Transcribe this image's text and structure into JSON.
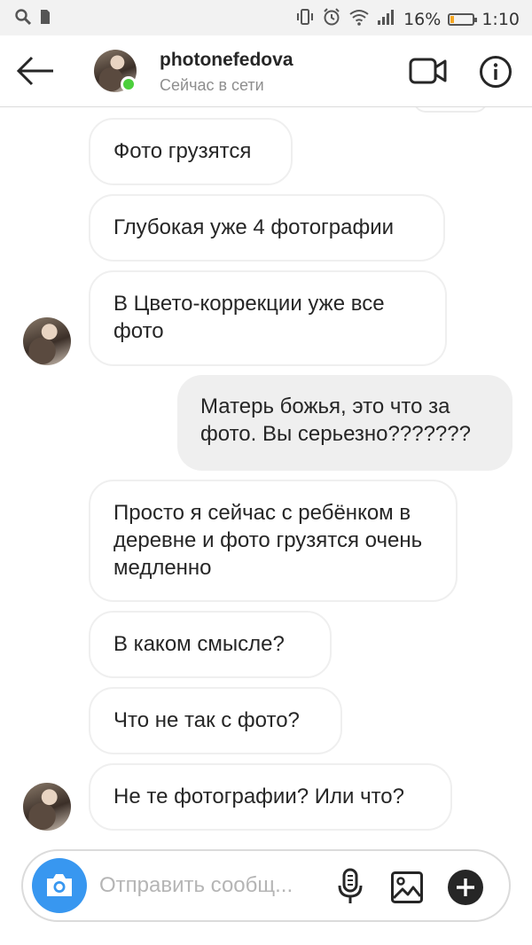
{
  "status_bar": {
    "icons_left": [
      "search-icon",
      "sim-icon"
    ],
    "icons_right": [
      "vibrate-icon",
      "alarm-icon",
      "wifi-icon",
      "signal-icon"
    ],
    "battery_percent": "16%",
    "battery_level": 0.16,
    "battery_color": "#f5a623",
    "time": "1:10"
  },
  "header": {
    "username": "photonefedova",
    "presence": "Сейчас в сети",
    "online_color": "#4ccf3c"
  },
  "messages": [
    {
      "side": "in",
      "text": "Фото грузятся"
    },
    {
      "side": "in",
      "text": "Глубокая уже 4 фотографии"
    },
    {
      "side": "in",
      "text": "В Цвето-коррекции уже все фото"
    },
    {
      "side": "out",
      "text": "Матерь божья, это что за фото. Вы серьезно???????"
    },
    {
      "side": "in",
      "text": "Просто я сейчас с ребёнком в деревне и фото грузятся очень медленно"
    },
    {
      "side": "in",
      "text": "В каком смысле?"
    },
    {
      "side": "in",
      "text": "Что не так с фото?"
    },
    {
      "side": "in",
      "text": "Не те фотографии? Или что?"
    }
  ],
  "composer": {
    "placeholder": "Отправить сообщ...",
    "camera_color": "#3897f0"
  }
}
